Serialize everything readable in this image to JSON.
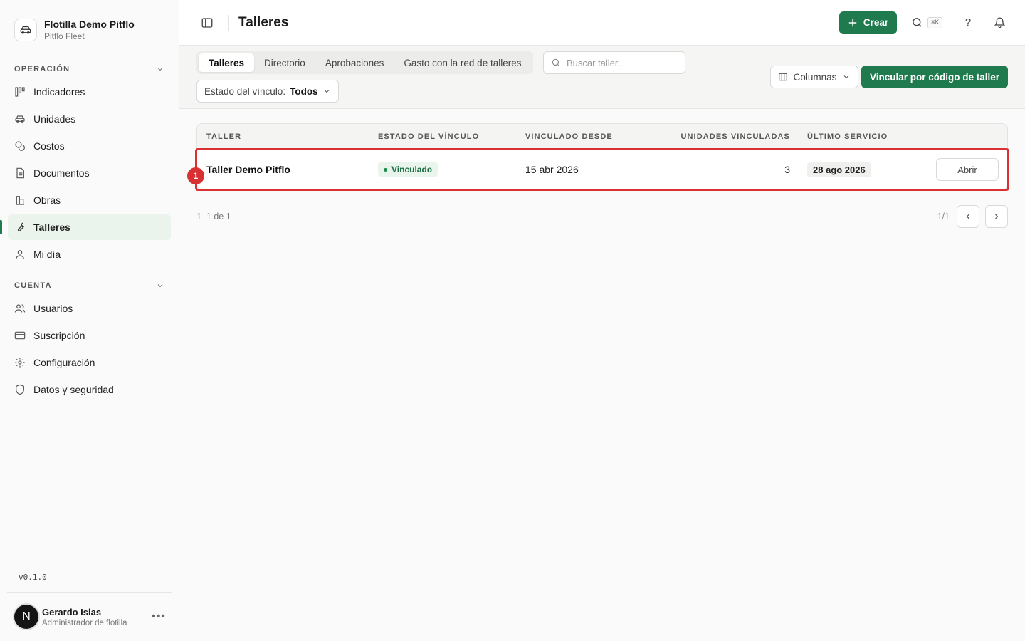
{
  "brand": {
    "name": "Flotilla Demo Pitflo",
    "subtitle": "Pitflo Fleet"
  },
  "sidebar": {
    "sections": [
      {
        "title": "OPERACIÓN",
        "items": [
          {
            "label": "Indicadores",
            "icon": "kanban-icon"
          },
          {
            "label": "Unidades",
            "icon": "car-icon"
          },
          {
            "label": "Costos",
            "icon": "coins-icon"
          },
          {
            "label": "Documentos",
            "icon": "document-icon"
          },
          {
            "label": "Obras",
            "icon": "building-icon"
          },
          {
            "label": "Talleres",
            "icon": "wrench-icon",
            "active": true
          },
          {
            "label": "Mi día",
            "icon": "user-icon"
          }
        ]
      },
      {
        "title": "CUENTA",
        "items": [
          {
            "label": "Usuarios",
            "icon": "users-icon"
          },
          {
            "label": "Suscripción",
            "icon": "credit-card-icon"
          },
          {
            "label": "Configuración",
            "icon": "gear-icon"
          },
          {
            "label": "Datos y seguridad",
            "icon": "shield-icon"
          }
        ]
      }
    ],
    "version": "v0.1.0"
  },
  "user": {
    "initial": "N",
    "name": "Gerardo Islas",
    "role": "Administrador de flotilla"
  },
  "header": {
    "title": "Talleres",
    "create_label": "Crear",
    "shortcut": "⌘K",
    "help": "?"
  },
  "toolbar": {
    "tabs": [
      {
        "label": "Talleres",
        "active": true
      },
      {
        "label": "Directorio"
      },
      {
        "label": "Aprobaciones"
      },
      {
        "label": "Gasto con la red de talleres"
      }
    ],
    "search_placeholder": "Buscar taller...",
    "filter_label": "Estado del vínculo:",
    "filter_value": "Todos",
    "columns_label": "Columnas",
    "link_button_label": "Vincular por código de taller"
  },
  "table": {
    "headers": [
      "TALLER",
      "ESTADO DEL VÍNCULO",
      "VINCULADO DESDE",
      "UNIDADES VINCULADAS",
      "ÚLTIMO SERVICIO"
    ],
    "rows": [
      {
        "taller": "Taller Demo Pitflo",
        "estado": "Vinculado",
        "desde": "15 abr 2026",
        "unidades": "3",
        "ultimo": "28 ago 2026",
        "action": "Abrir"
      }
    ],
    "highlight_marker": "1"
  },
  "pager": {
    "count": "1–1 de 1",
    "pages": "1/1"
  },
  "colors": {
    "accent": "#1f7a4d",
    "highlight": "#d93033",
    "badge_bg": "#e8f4ec"
  }
}
